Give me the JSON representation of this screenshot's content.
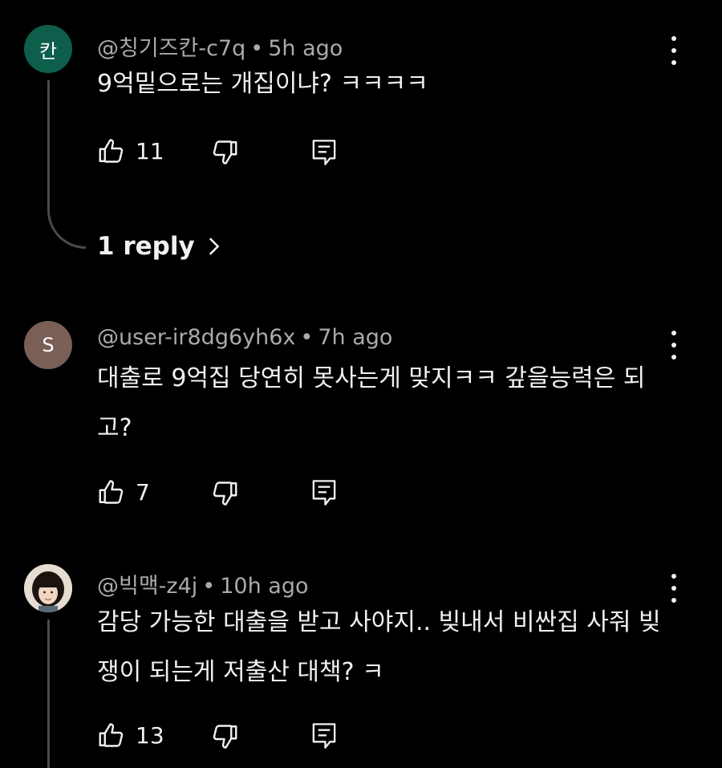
{
  "comments": [
    {
      "avatar_letter": "칸",
      "avatar_color": "#0d5e4a",
      "username": "@칭기즈칸-c7q",
      "separator": "•",
      "time": "5h ago",
      "text": "9억밑으로는 개집이냐? ㅋㅋㅋㅋ",
      "likes": "11",
      "replies_label": "1 reply"
    },
    {
      "avatar_letter": "S",
      "avatar_color": "#7a5f57",
      "username": "@user-ir8dg6yh6x",
      "separator": "•",
      "time": "7h ago",
      "text": "대출로 9억집 당연히 못사는게 맞지ㅋㅋ  갚을능력은 되고?",
      "likes": "7"
    },
    {
      "avatar_letter": "",
      "avatar_color": "#d9c9b6",
      "username": "@빅맥-z4j",
      "separator": "•",
      "time": "10h ago",
      "text": "감당 가능한 대출을 받고 사야지.. 빚내서 비싼집 사줘 빚쟁이 되는게 저출산 대책? ㅋ",
      "likes": "13"
    }
  ],
  "icons": {
    "like": "thumb-up-icon",
    "dislike": "thumb-down-icon",
    "reply": "comment-icon",
    "more": "more-vertical-icon",
    "chevron": "chevron-right-icon"
  }
}
